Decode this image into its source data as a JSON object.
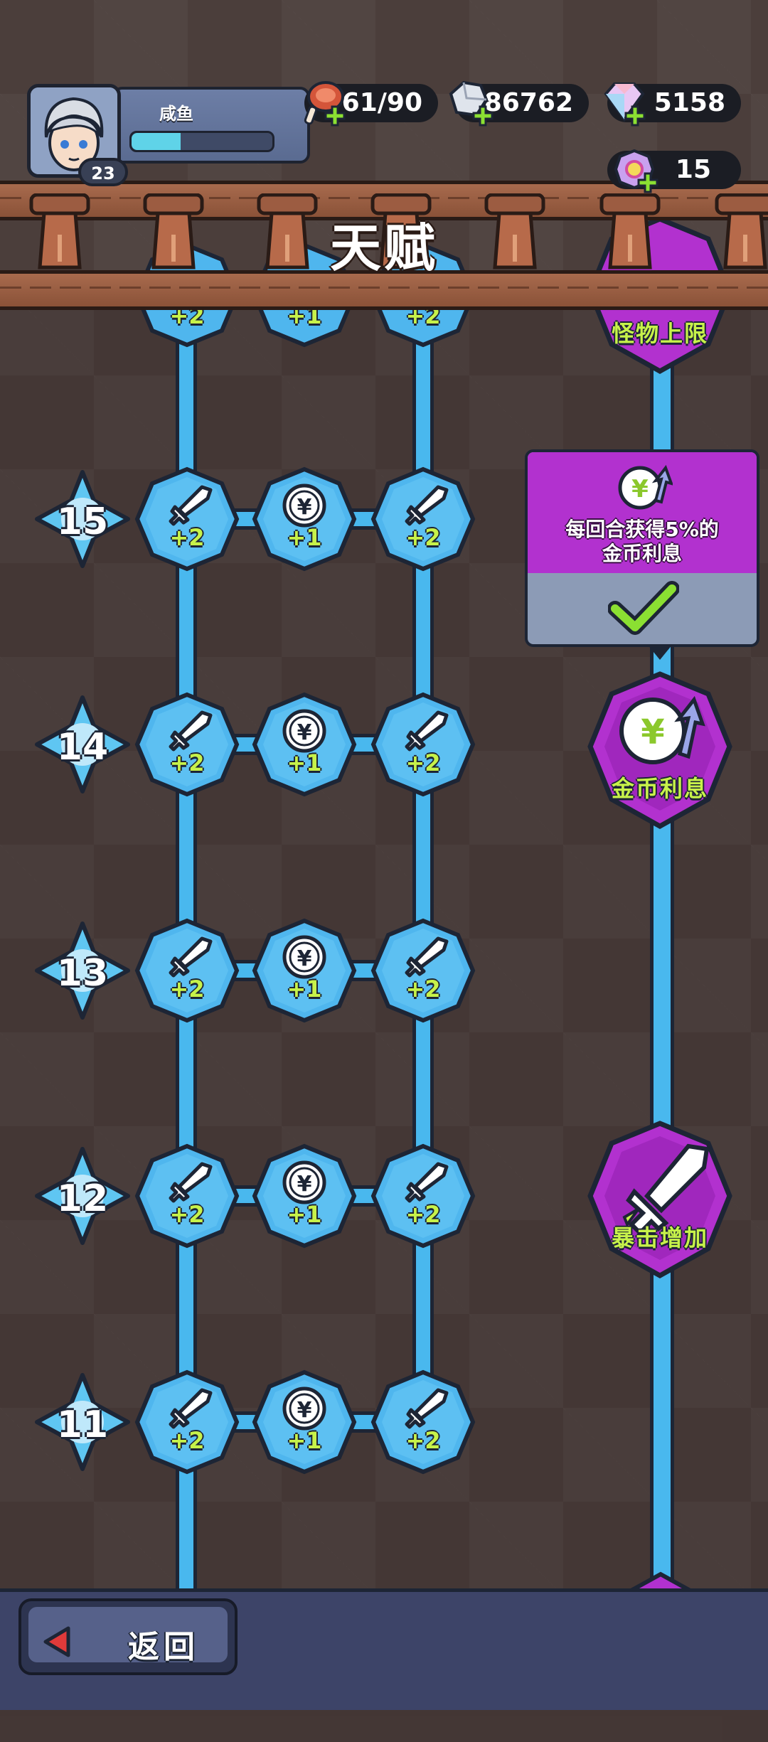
{
  "player": {
    "name": "咸鱼",
    "level": "23",
    "exp_fraction": 0.35
  },
  "resources": {
    "energy": "61/90",
    "silver": "86762",
    "gems": "5158",
    "rune": "15"
  },
  "header": {
    "title": "天赋"
  },
  "tree_rows": [
    {
      "row": "15",
      "left": "+2",
      "mid": "+1",
      "right": "+2"
    },
    {
      "row": "14",
      "left": "+2",
      "mid": "+1",
      "right": "+2"
    },
    {
      "row": "13",
      "left": "+2",
      "mid": "+1",
      "right": "+2"
    },
    {
      "row": "12",
      "left": "+2",
      "mid": "+1",
      "right": "+2"
    },
    {
      "row": "11",
      "left": "+2",
      "mid": "+1",
      "right": "+2"
    }
  ],
  "partial_top_row": {
    "left": "+2",
    "mid": "+1",
    "right": "+2"
  },
  "special_nodes": {
    "top": "怪物上限",
    "gold_interest": "金币利息",
    "crit": "暴击增加"
  },
  "tooltip": {
    "line1": "每回合获得5%的",
    "line2": "金币利息"
  },
  "footer": {
    "back_label": "返回"
  },
  "colors": {
    "pipe": "#49b8ee",
    "node_blue": "#4fb6ee",
    "special_purple": "#b231cf",
    "value_green": "#c7f24a"
  }
}
